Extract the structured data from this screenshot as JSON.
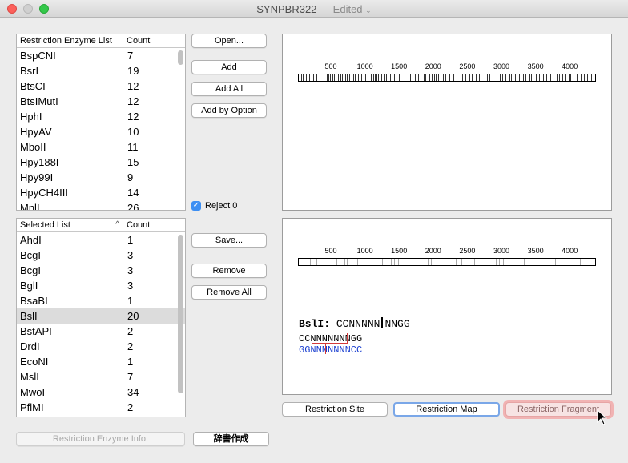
{
  "window": {
    "title": "SYNPBR322",
    "separator": "—",
    "status": "Edited",
    "status_chevron": "⌄"
  },
  "enzyme_table": {
    "headers": [
      "Restriction Enzyme List",
      "Count"
    ],
    "rows": [
      [
        "BspCNI",
        "7"
      ],
      [
        "BsrI",
        "19"
      ],
      [
        "BtsCI",
        "12"
      ],
      [
        "BtsIMutI",
        "12"
      ],
      [
        "HphI",
        "12"
      ],
      [
        "HpyAV",
        "10"
      ],
      [
        "MboII",
        "11"
      ],
      [
        "Hpy188I",
        "15"
      ],
      [
        "Hpy99I",
        "9"
      ],
      [
        "HpyCH4III",
        "14"
      ],
      [
        "MnlI",
        "26"
      ]
    ]
  },
  "selected_table": {
    "headers": [
      "Selected List",
      "Count"
    ],
    "sort_indicator": "^",
    "rows": [
      [
        "AhdI",
        "1"
      ],
      [
        "BcgI",
        "3"
      ],
      [
        "BcgI",
        "3"
      ],
      [
        "BglI",
        "3"
      ],
      [
        "BsaBI",
        "1"
      ],
      [
        "BslI",
        "20"
      ],
      [
        "BstAPI",
        "2"
      ],
      [
        "DrdI",
        "2"
      ],
      [
        "EcoNI",
        "1"
      ],
      [
        "MslI",
        "7"
      ],
      [
        "MwoI",
        "34"
      ],
      [
        "PflMI",
        "2"
      ]
    ],
    "selected_index": 5
  },
  "buttons": {
    "open": "Open...",
    "add": "Add",
    "add_all": "Add All",
    "add_by_option": "Add by Option",
    "save": "Save...",
    "remove": "Remove",
    "remove_all": "Remove All",
    "restriction_site": "Restriction Site",
    "restriction_map": "Restriction Map",
    "restriction_fragment": "Restriction Fragment",
    "enzyme_info": "Restriction Enzyme Info.",
    "dictionary": "辞書作成"
  },
  "reject_checkbox": {
    "label": "Reject 0",
    "checked": true,
    "check_glyph": "✓"
  },
  "ruler_ticks": [
    "500",
    "1000",
    "1500",
    "2000",
    "2500",
    "3000",
    "3500",
    "4000"
  ],
  "site_detail": {
    "enzyme": "BslI:",
    "pattern_left": "CCNNNNN",
    "pattern_right": "NNGG",
    "top_strand": "CCNNNNNNNGG",
    "bottom_strand": "GGNNNNNNNCC"
  },
  "colors": {
    "accent": "#3d8ff3",
    "bottom_strand": "#1a3fd0",
    "cut": "#d43a3a",
    "pressed": "#f1b3b3"
  }
}
